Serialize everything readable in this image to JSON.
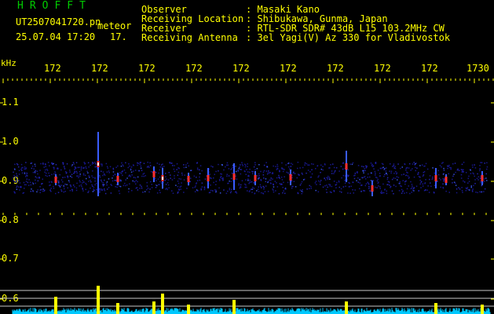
{
  "header": {
    "brand": "HROFFT",
    "filename": "UT2507041720.pn",
    "meteor_label": "meteor",
    "datetime": "25.07.04 17:20",
    "count": "17.",
    "fields": [
      {
        "label": "Observer",
        "value": ": Masaki Kano"
      },
      {
        "label": "Receiving Location",
        "value": ": Shibukawa, Gunma, Japan"
      },
      {
        "label": "Receiver",
        "value": ": RTL-SDR SDR# 43dB L15 103.2MHz CW"
      },
      {
        "label": "Receiving Antenna",
        "value": ": 3el Yagi(V) Az 330 for Vladivostok"
      }
    ]
  },
  "axis": {
    "y_unit": "kHz",
    "y_ticks": [
      "1.1",
      "1.0",
      "0.9",
      "0.8",
      "0.7",
      "0.6"
    ],
    "x_ticks": [
      "172",
      "172",
      "172",
      "172",
      "172",
      "172",
      "172",
      "172",
      "172",
      "1730"
    ]
  },
  "colors": {
    "text": "#ffff00",
    "brand": "#00cc00",
    "background": "#000000",
    "signal_band": "#1a1aa0",
    "meteor": "#ff3030",
    "noise_floor": "#00c8ff",
    "peak": "#ffff00"
  }
}
